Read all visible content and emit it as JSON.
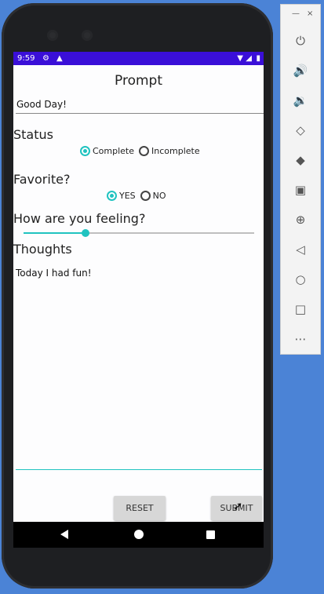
{
  "status_bar": {
    "time": "9:59",
    "left_icons": [
      "gear-icon",
      "warning-icon"
    ],
    "right_icons": [
      "wifi-icon",
      "signal-icon",
      "battery-icon"
    ]
  },
  "app": {
    "title": "Prompt",
    "title_input_value": "Good Day!",
    "status": {
      "label": "Status",
      "options": [
        "Complete",
        "Incomplete"
      ],
      "selected": "Complete"
    },
    "favorite": {
      "label": "Favorite?",
      "options": [
        "YES",
        "NO"
      ],
      "selected": "YES"
    },
    "feeling": {
      "label": "How are you feeling?",
      "value_fraction": 0.27
    },
    "thoughts": {
      "label": "Thoughts",
      "value": "Today I had fun!"
    },
    "buttons": {
      "reset": "RESET",
      "submit": "SUBMIT"
    }
  },
  "colors": {
    "status_bar": "#3a0fd8",
    "accent": "#20c3c0",
    "background": "#4b83d6"
  },
  "emulator_toolbar": {
    "window_controls": [
      "×",
      "—"
    ],
    "tools": [
      "power-icon",
      "volume-up-icon",
      "volume-down-icon",
      "rotate-left-icon",
      "rotate-right-icon",
      "camera-icon",
      "zoom-icon",
      "back-icon",
      "home-icon",
      "overview-icon",
      "more-icon"
    ]
  }
}
